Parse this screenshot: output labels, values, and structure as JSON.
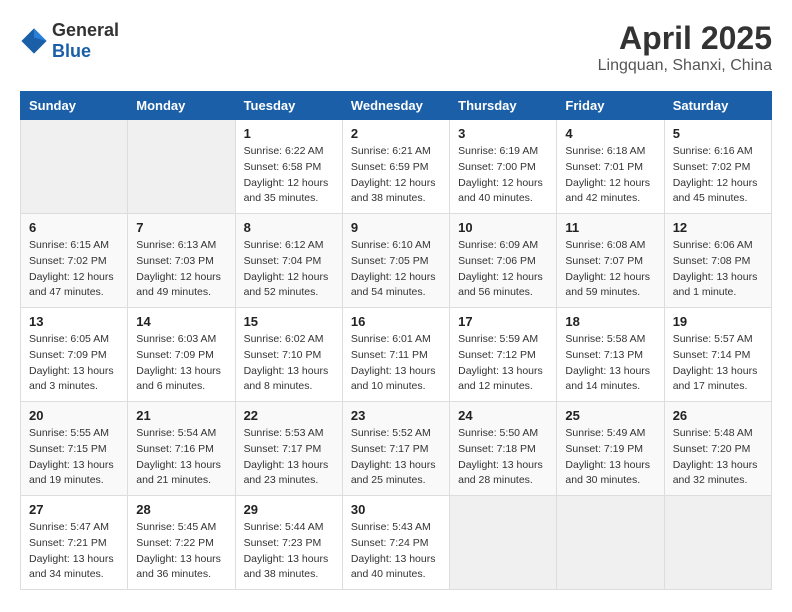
{
  "header": {
    "logo_general": "General",
    "logo_blue": "Blue",
    "month": "April 2025",
    "location": "Lingquan, Shanxi, China"
  },
  "weekdays": [
    "Sunday",
    "Monday",
    "Tuesday",
    "Wednesday",
    "Thursday",
    "Friday",
    "Saturday"
  ],
  "weeks": [
    [
      {
        "day": "",
        "info": ""
      },
      {
        "day": "",
        "info": ""
      },
      {
        "day": "1",
        "info": "Sunrise: 6:22 AM\nSunset: 6:58 PM\nDaylight: 12 hours and 35 minutes."
      },
      {
        "day": "2",
        "info": "Sunrise: 6:21 AM\nSunset: 6:59 PM\nDaylight: 12 hours and 38 minutes."
      },
      {
        "day": "3",
        "info": "Sunrise: 6:19 AM\nSunset: 7:00 PM\nDaylight: 12 hours and 40 minutes."
      },
      {
        "day": "4",
        "info": "Sunrise: 6:18 AM\nSunset: 7:01 PM\nDaylight: 12 hours and 42 minutes."
      },
      {
        "day": "5",
        "info": "Sunrise: 6:16 AM\nSunset: 7:02 PM\nDaylight: 12 hours and 45 minutes."
      }
    ],
    [
      {
        "day": "6",
        "info": "Sunrise: 6:15 AM\nSunset: 7:02 PM\nDaylight: 12 hours and 47 minutes."
      },
      {
        "day": "7",
        "info": "Sunrise: 6:13 AM\nSunset: 7:03 PM\nDaylight: 12 hours and 49 minutes."
      },
      {
        "day": "8",
        "info": "Sunrise: 6:12 AM\nSunset: 7:04 PM\nDaylight: 12 hours and 52 minutes."
      },
      {
        "day": "9",
        "info": "Sunrise: 6:10 AM\nSunset: 7:05 PM\nDaylight: 12 hours and 54 minutes."
      },
      {
        "day": "10",
        "info": "Sunrise: 6:09 AM\nSunset: 7:06 PM\nDaylight: 12 hours and 56 minutes."
      },
      {
        "day": "11",
        "info": "Sunrise: 6:08 AM\nSunset: 7:07 PM\nDaylight: 12 hours and 59 minutes."
      },
      {
        "day": "12",
        "info": "Sunrise: 6:06 AM\nSunset: 7:08 PM\nDaylight: 13 hours and 1 minute."
      }
    ],
    [
      {
        "day": "13",
        "info": "Sunrise: 6:05 AM\nSunset: 7:09 PM\nDaylight: 13 hours and 3 minutes."
      },
      {
        "day": "14",
        "info": "Sunrise: 6:03 AM\nSunset: 7:09 PM\nDaylight: 13 hours and 6 minutes."
      },
      {
        "day": "15",
        "info": "Sunrise: 6:02 AM\nSunset: 7:10 PM\nDaylight: 13 hours and 8 minutes."
      },
      {
        "day": "16",
        "info": "Sunrise: 6:01 AM\nSunset: 7:11 PM\nDaylight: 13 hours and 10 minutes."
      },
      {
        "day": "17",
        "info": "Sunrise: 5:59 AM\nSunset: 7:12 PM\nDaylight: 13 hours and 12 minutes."
      },
      {
        "day": "18",
        "info": "Sunrise: 5:58 AM\nSunset: 7:13 PM\nDaylight: 13 hours and 14 minutes."
      },
      {
        "day": "19",
        "info": "Sunrise: 5:57 AM\nSunset: 7:14 PM\nDaylight: 13 hours and 17 minutes."
      }
    ],
    [
      {
        "day": "20",
        "info": "Sunrise: 5:55 AM\nSunset: 7:15 PM\nDaylight: 13 hours and 19 minutes."
      },
      {
        "day": "21",
        "info": "Sunrise: 5:54 AM\nSunset: 7:16 PM\nDaylight: 13 hours and 21 minutes."
      },
      {
        "day": "22",
        "info": "Sunrise: 5:53 AM\nSunset: 7:17 PM\nDaylight: 13 hours and 23 minutes."
      },
      {
        "day": "23",
        "info": "Sunrise: 5:52 AM\nSunset: 7:17 PM\nDaylight: 13 hours and 25 minutes."
      },
      {
        "day": "24",
        "info": "Sunrise: 5:50 AM\nSunset: 7:18 PM\nDaylight: 13 hours and 28 minutes."
      },
      {
        "day": "25",
        "info": "Sunrise: 5:49 AM\nSunset: 7:19 PM\nDaylight: 13 hours and 30 minutes."
      },
      {
        "day": "26",
        "info": "Sunrise: 5:48 AM\nSunset: 7:20 PM\nDaylight: 13 hours and 32 minutes."
      }
    ],
    [
      {
        "day": "27",
        "info": "Sunrise: 5:47 AM\nSunset: 7:21 PM\nDaylight: 13 hours and 34 minutes."
      },
      {
        "day": "28",
        "info": "Sunrise: 5:45 AM\nSunset: 7:22 PM\nDaylight: 13 hours and 36 minutes."
      },
      {
        "day": "29",
        "info": "Sunrise: 5:44 AM\nSunset: 7:23 PM\nDaylight: 13 hours and 38 minutes."
      },
      {
        "day": "30",
        "info": "Sunrise: 5:43 AM\nSunset: 7:24 PM\nDaylight: 13 hours and 40 minutes."
      },
      {
        "day": "",
        "info": ""
      },
      {
        "day": "",
        "info": ""
      },
      {
        "day": "",
        "info": ""
      }
    ]
  ]
}
